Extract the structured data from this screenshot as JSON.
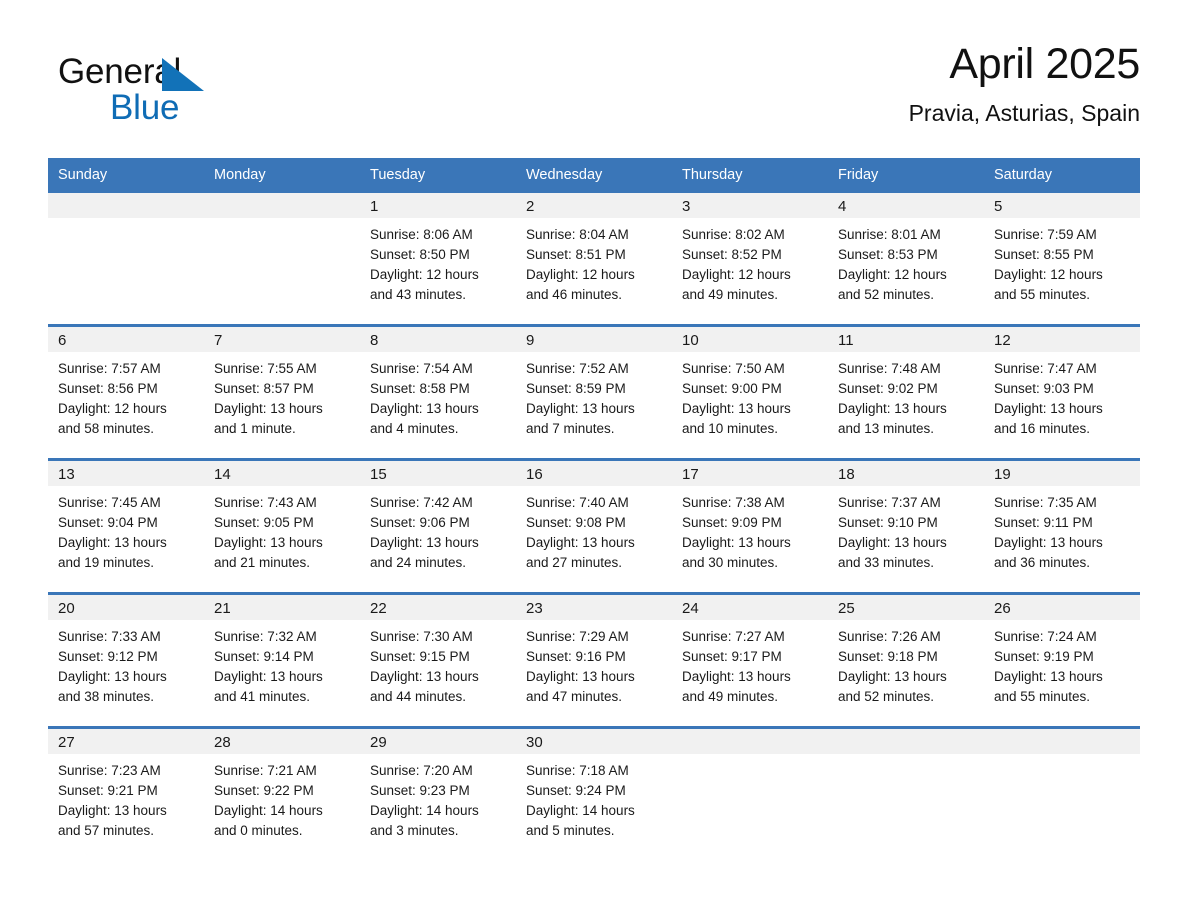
{
  "brand": {
    "name_part1": "General",
    "name_part2": "Blue",
    "triangle_color": "#1272b8",
    "blue_color": "#0f6cb5"
  },
  "header": {
    "month_title": "April 2025",
    "location": "Pravia, Asturias, Spain"
  },
  "theme": {
    "header_blue": "#3a76b8",
    "daynum_band": "#f1f1f1",
    "background": "#ffffff",
    "text": "#1a1a1a"
  },
  "weekday_headers": [
    "Sunday",
    "Monday",
    "Tuesday",
    "Wednesday",
    "Thursday",
    "Friday",
    "Saturday"
  ],
  "weeks": [
    [
      {
        "day": "",
        "lines": []
      },
      {
        "day": "",
        "lines": []
      },
      {
        "day": "1",
        "lines": [
          "Sunrise: 8:06 AM",
          "Sunset: 8:50 PM",
          "Daylight: 12 hours",
          "and 43 minutes."
        ]
      },
      {
        "day": "2",
        "lines": [
          "Sunrise: 8:04 AM",
          "Sunset: 8:51 PM",
          "Daylight: 12 hours",
          "and 46 minutes."
        ]
      },
      {
        "day": "3",
        "lines": [
          "Sunrise: 8:02 AM",
          "Sunset: 8:52 PM",
          "Daylight: 12 hours",
          "and 49 minutes."
        ]
      },
      {
        "day": "4",
        "lines": [
          "Sunrise: 8:01 AM",
          "Sunset: 8:53 PM",
          "Daylight: 12 hours",
          "and 52 minutes."
        ]
      },
      {
        "day": "5",
        "lines": [
          "Sunrise: 7:59 AM",
          "Sunset: 8:55 PM",
          "Daylight: 12 hours",
          "and 55 minutes."
        ]
      }
    ],
    [
      {
        "day": "6",
        "lines": [
          "Sunrise: 7:57 AM",
          "Sunset: 8:56 PM",
          "Daylight: 12 hours",
          "and 58 minutes."
        ]
      },
      {
        "day": "7",
        "lines": [
          "Sunrise: 7:55 AM",
          "Sunset: 8:57 PM",
          "Daylight: 13 hours",
          "and 1 minute."
        ]
      },
      {
        "day": "8",
        "lines": [
          "Sunrise: 7:54 AM",
          "Sunset: 8:58 PM",
          "Daylight: 13 hours",
          "and 4 minutes."
        ]
      },
      {
        "day": "9",
        "lines": [
          "Sunrise: 7:52 AM",
          "Sunset: 8:59 PM",
          "Daylight: 13 hours",
          "and 7 minutes."
        ]
      },
      {
        "day": "10",
        "lines": [
          "Sunrise: 7:50 AM",
          "Sunset: 9:00 PM",
          "Daylight: 13 hours",
          "and 10 minutes."
        ]
      },
      {
        "day": "11",
        "lines": [
          "Sunrise: 7:48 AM",
          "Sunset: 9:02 PM",
          "Daylight: 13 hours",
          "and 13 minutes."
        ]
      },
      {
        "day": "12",
        "lines": [
          "Sunrise: 7:47 AM",
          "Sunset: 9:03 PM",
          "Daylight: 13 hours",
          "and 16 minutes."
        ]
      }
    ],
    [
      {
        "day": "13",
        "lines": [
          "Sunrise: 7:45 AM",
          "Sunset: 9:04 PM",
          "Daylight: 13 hours",
          "and 19 minutes."
        ]
      },
      {
        "day": "14",
        "lines": [
          "Sunrise: 7:43 AM",
          "Sunset: 9:05 PM",
          "Daylight: 13 hours",
          "and 21 minutes."
        ]
      },
      {
        "day": "15",
        "lines": [
          "Sunrise: 7:42 AM",
          "Sunset: 9:06 PM",
          "Daylight: 13 hours",
          "and 24 minutes."
        ]
      },
      {
        "day": "16",
        "lines": [
          "Sunrise: 7:40 AM",
          "Sunset: 9:08 PM",
          "Daylight: 13 hours",
          "and 27 minutes."
        ]
      },
      {
        "day": "17",
        "lines": [
          "Sunrise: 7:38 AM",
          "Sunset: 9:09 PM",
          "Daylight: 13 hours",
          "and 30 minutes."
        ]
      },
      {
        "day": "18",
        "lines": [
          "Sunrise: 7:37 AM",
          "Sunset: 9:10 PM",
          "Daylight: 13 hours",
          "and 33 minutes."
        ]
      },
      {
        "day": "19",
        "lines": [
          "Sunrise: 7:35 AM",
          "Sunset: 9:11 PM",
          "Daylight: 13 hours",
          "and 36 minutes."
        ]
      }
    ],
    [
      {
        "day": "20",
        "lines": [
          "Sunrise: 7:33 AM",
          "Sunset: 9:12 PM",
          "Daylight: 13 hours",
          "and 38 minutes."
        ]
      },
      {
        "day": "21",
        "lines": [
          "Sunrise: 7:32 AM",
          "Sunset: 9:14 PM",
          "Daylight: 13 hours",
          "and 41 minutes."
        ]
      },
      {
        "day": "22",
        "lines": [
          "Sunrise: 7:30 AM",
          "Sunset: 9:15 PM",
          "Daylight: 13 hours",
          "and 44 minutes."
        ]
      },
      {
        "day": "23",
        "lines": [
          "Sunrise: 7:29 AM",
          "Sunset: 9:16 PM",
          "Daylight: 13 hours",
          "and 47 minutes."
        ]
      },
      {
        "day": "24",
        "lines": [
          "Sunrise: 7:27 AM",
          "Sunset: 9:17 PM",
          "Daylight: 13 hours",
          "and 49 minutes."
        ]
      },
      {
        "day": "25",
        "lines": [
          "Sunrise: 7:26 AM",
          "Sunset: 9:18 PM",
          "Daylight: 13 hours",
          "and 52 minutes."
        ]
      },
      {
        "day": "26",
        "lines": [
          "Sunrise: 7:24 AM",
          "Sunset: 9:19 PM",
          "Daylight: 13 hours",
          "and 55 minutes."
        ]
      }
    ],
    [
      {
        "day": "27",
        "lines": [
          "Sunrise: 7:23 AM",
          "Sunset: 9:21 PM",
          "Daylight: 13 hours",
          "and 57 minutes."
        ]
      },
      {
        "day": "28",
        "lines": [
          "Sunrise: 7:21 AM",
          "Sunset: 9:22 PM",
          "Daylight: 14 hours",
          "and 0 minutes."
        ]
      },
      {
        "day": "29",
        "lines": [
          "Sunrise: 7:20 AM",
          "Sunset: 9:23 PM",
          "Daylight: 14 hours",
          "and 3 minutes."
        ]
      },
      {
        "day": "30",
        "lines": [
          "Sunrise: 7:18 AM",
          "Sunset: 9:24 PM",
          "Daylight: 14 hours",
          "and 5 minutes."
        ]
      },
      {
        "day": "",
        "lines": []
      },
      {
        "day": "",
        "lines": []
      },
      {
        "day": "",
        "lines": []
      }
    ]
  ]
}
